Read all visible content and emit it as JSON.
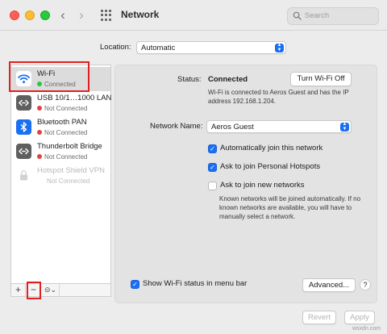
{
  "window": {
    "title": "Network"
  },
  "search": {
    "placeholder": "Search"
  },
  "location": {
    "label": "Location:",
    "value": "Automatic"
  },
  "services": [
    {
      "name": "Wi-Fi",
      "status": "Connected",
      "status_color": "#28c840",
      "icon": "wifi-icon",
      "selected": true
    },
    {
      "name": "USB 10/1…1000 LAN",
      "status": "Not Connected",
      "status_color": "#e0443e",
      "icon": "ethernet-icon"
    },
    {
      "name": "Bluetooth PAN",
      "status": "Not Connected",
      "status_color": "#e0443e",
      "icon": "bluetooth-icon"
    },
    {
      "name": "Thunderbolt Bridge",
      "status": "Not Connected",
      "status_color": "#e0443e",
      "icon": "thunderbolt-bridge-icon"
    },
    {
      "name": "Hotspot Shield VPN",
      "status": "Not Connected",
      "icon": "vpn-lock-icon",
      "disabled": true
    }
  ],
  "sidebar_buttons": {
    "add": "+",
    "remove": "−",
    "action": "⊝⌄"
  },
  "detail": {
    "status_label": "Status:",
    "status_value": "Connected",
    "turn_off_button": "Turn Wi-Fi Off",
    "status_description": "Wi-Fi is connected to Aeros Guest and has the IP address 192.168.1.204.",
    "network_name_label": "Network Name:",
    "network_name_value": "Aeros Guest",
    "auto_join": {
      "label": "Automatically join this network",
      "checked": true
    },
    "personal_hotspots": {
      "label": "Ask to join Personal Hotspots",
      "checked": true
    },
    "new_networks": {
      "label": "Ask to join new networks",
      "checked": false
    },
    "known_networks_description": "Known networks will be joined automatically. If no known networks are available, you will have to manually select a network.",
    "show_status": {
      "label": "Show Wi-Fi status in menu bar",
      "checked": true
    },
    "advanced_button": "Advanced...",
    "help_button": "?"
  },
  "footer": {
    "revert_button": "Revert",
    "apply_button": "Apply"
  },
  "watermark": "wsxdn.com",
  "colors": {
    "accent": "#1a6ff3",
    "highlight": "#e12121"
  }
}
